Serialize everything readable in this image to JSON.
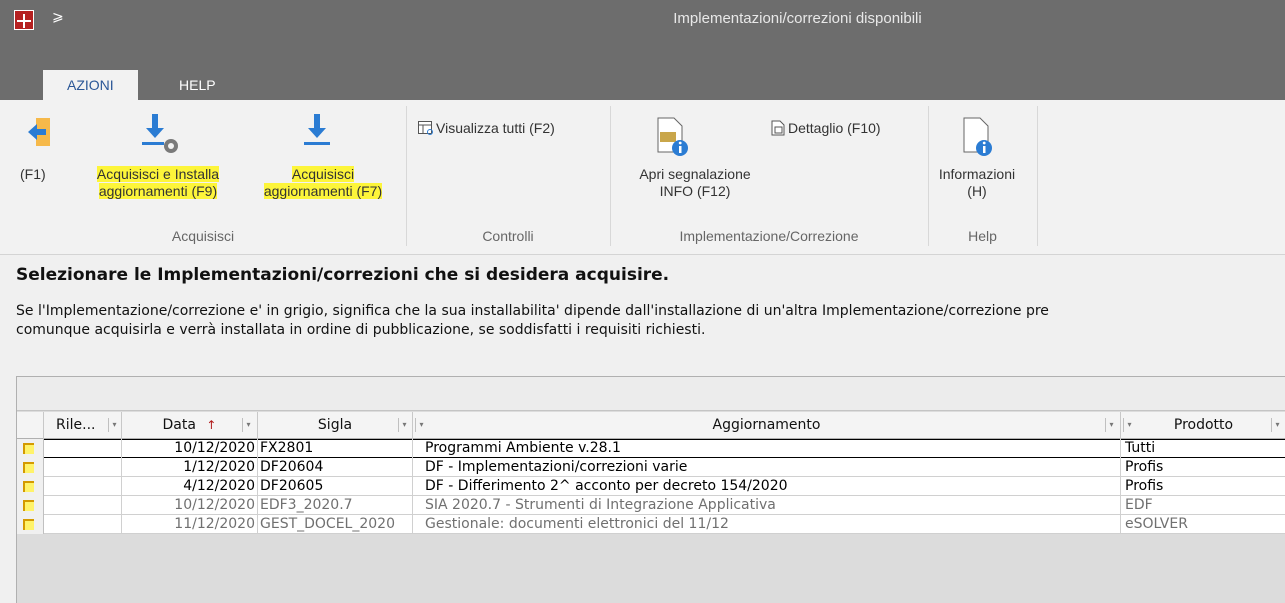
{
  "window": {
    "title": "Implementazioni/correzioni disponibili",
    "qat_glyph": "⩾"
  },
  "tabs": [
    {
      "label": "AZIONI"
    },
    {
      "label": "HELP"
    }
  ],
  "ribbon": {
    "groups": [
      {
        "label": "Acquisisci"
      },
      {
        "label": "Controlli"
      },
      {
        "label": "Implementazione/Correzione"
      },
      {
        "label": "Help"
      }
    ],
    "buttons": {
      "back_f1": "(F1)",
      "acquire_install_1": "Acquisisci e Installa",
      "acquire_install_2": "aggiornamenti (F9)",
      "acquire_1": "Acquisisci",
      "acquire_2": "aggiornamenti (F7)",
      "show_all": "Visualizza tutti (F2)",
      "open_report_1": "Apri segnalazione",
      "open_report_2": "INFO (F12)",
      "detail": "Dettaglio (F10)",
      "info_1": "Informazioni",
      "info_2": "(H)"
    }
  },
  "main": {
    "heading": "Selezionare le Implementazioni/correzioni che si desidera acquisire.",
    "desc_line1": "Se l'Implementazione/correzione e' in grigio, significa che la sua installabilita' dipende dall'installazione di un'altra Implementazione/correzione pre",
    "desc_line2": "comunque acquisirla e verrà installata in ordine di pubblicazione, se soddisfatti i requisiti richiesti."
  },
  "grid": {
    "columns": {
      "rile": "Rile...",
      "data": "Data",
      "sigla": "Sigla",
      "aggiornamento": "Aggiornamento",
      "prodotto": "Prodotto"
    },
    "sort_glyph": "↑",
    "filter_glyph": "▾",
    "rows": [
      {
        "rile": "",
        "data": "10/12/2020",
        "sigla": "FX2801",
        "aggiornamento": "Programmi Ambiente v.28.1",
        "prodotto": "Tutti"
      },
      {
        "rile": "",
        "data": "1/12/2020",
        "sigla": "DF20604",
        "aggiornamento": "DF - Implementazioni/correzioni varie",
        "prodotto": "Profis"
      },
      {
        "rile": "",
        "data": "4/12/2020",
        "sigla": "DF20605",
        "aggiornamento": "DF - Differimento 2^ acconto per decreto 154/2020",
        "prodotto": "Profis"
      },
      {
        "rile": "",
        "data": "10/12/2020",
        "sigla": "EDF3_2020.7",
        "aggiornamento": "SIA 2020.7 - Strumenti di Integrazione Applicativa",
        "prodotto": "EDF"
      },
      {
        "rile": "",
        "data": "11/12/2020",
        "sigla": "GEST_DOCEL_2020",
        "aggiornamento": "Gestionale: documenti elettronici del 11/12",
        "prodotto": "eSOLVER"
      }
    ]
  },
  "colors": {
    "titlebar": "#6d6d6d",
    "highlight": "#fdf53a",
    "accent": "#2b5797",
    "icon_blue": "#2b7cd3"
  }
}
